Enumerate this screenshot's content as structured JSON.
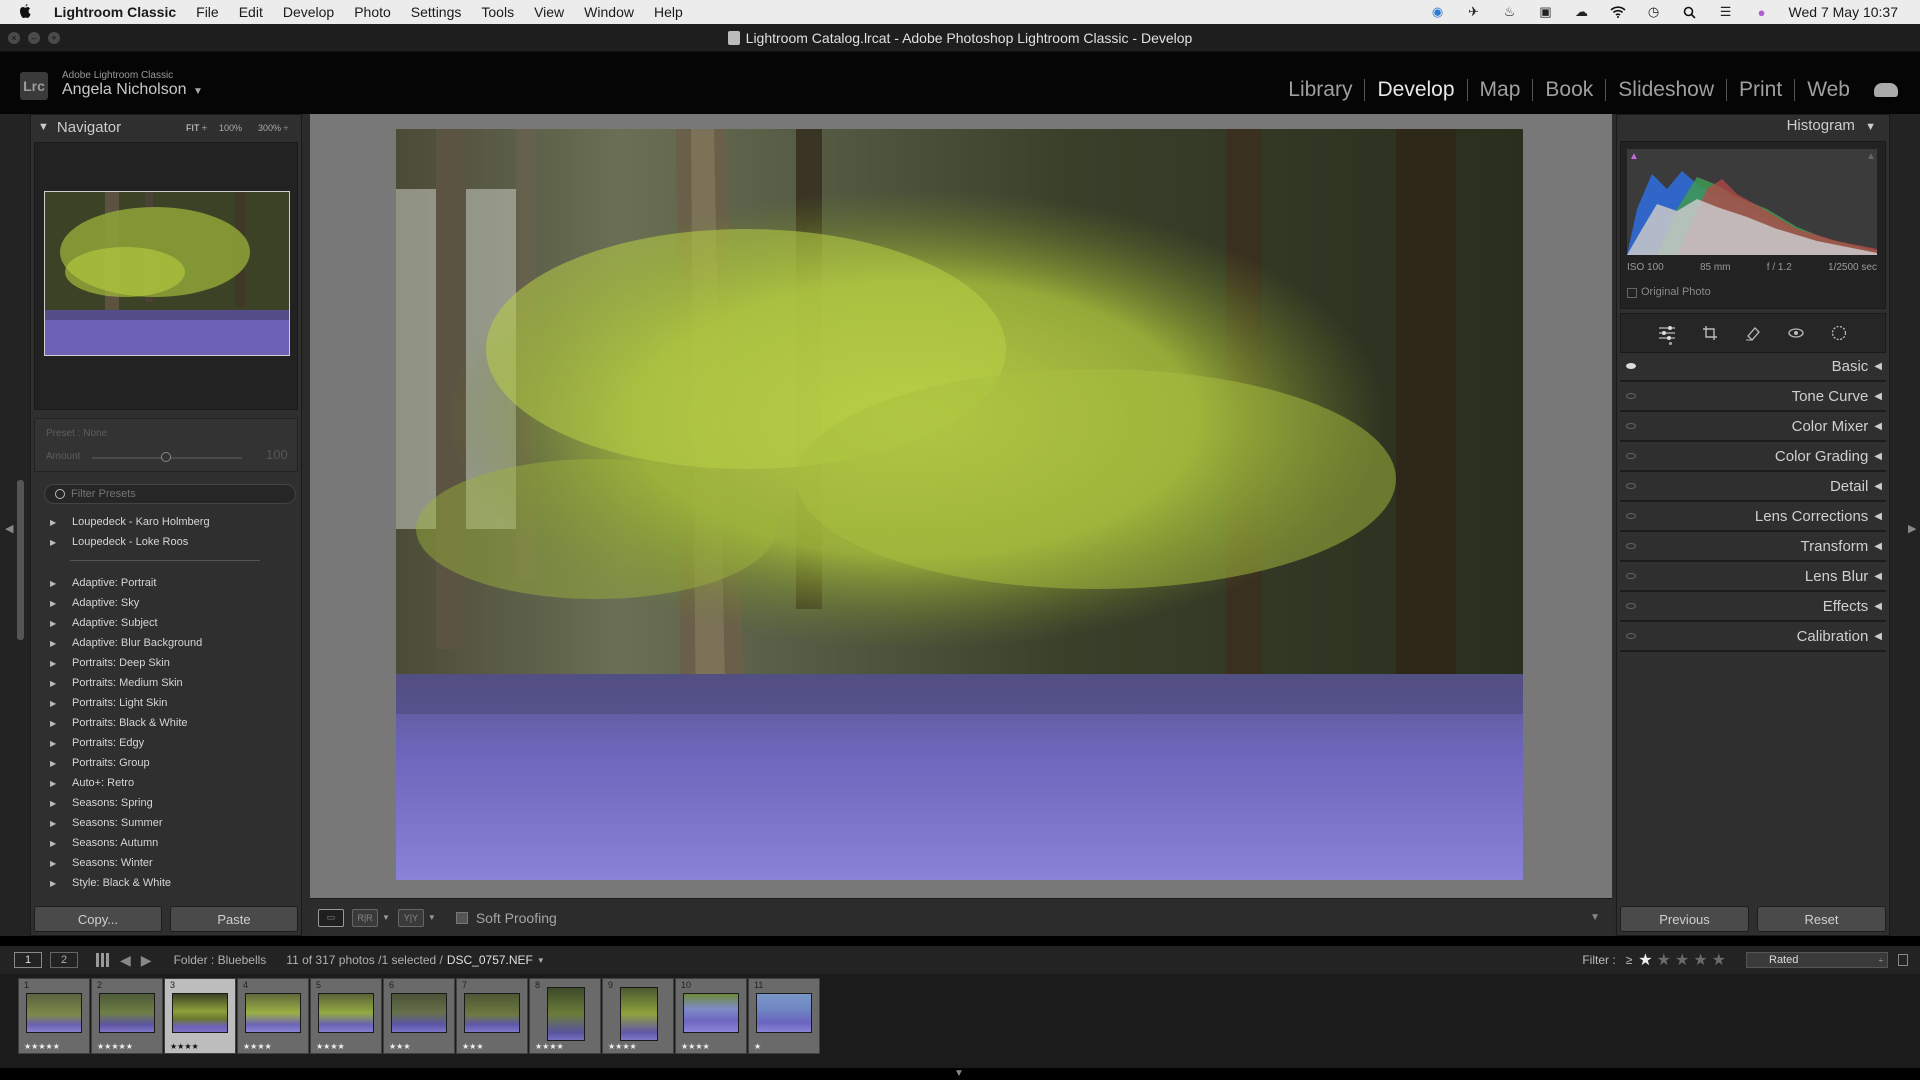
{
  "menubar": {
    "app_name": "Lightroom Classic",
    "items": [
      "File",
      "Edit",
      "Develop",
      "Photo",
      "Settings",
      "Tools",
      "View",
      "Window",
      "Help"
    ],
    "clock": "Wed 7 May  10:37"
  },
  "window": {
    "title": "Lightroom Catalog.lrcat - Adobe Photoshop Lightroom Classic - Develop"
  },
  "identity": {
    "logo": "Lrc",
    "product": "Adobe Lightroom Classic",
    "user": "Angela Nicholson"
  },
  "modules": [
    "Library",
    "Develop",
    "Map",
    "Book",
    "Slideshow",
    "Print",
    "Web"
  ],
  "active_module": "Develop",
  "navigator": {
    "title": "Navigator",
    "zoom_options": [
      "FIT ÷",
      "100%",
      "300% ÷"
    ]
  },
  "presets": {
    "preset_label": "Preset : None",
    "amount_label": "Amount",
    "amount_value": "100",
    "amount_fraction": 0.55,
    "filter_placeholder": "Filter Presets",
    "group1": [
      "Loupedeck - Karo Holmberg",
      "Loupedeck - Loke Roos"
    ],
    "group2": [
      "Adaptive: Portrait",
      "Adaptive: Sky",
      "Adaptive: Subject",
      "Adaptive: Blur Background",
      "Portraits: Deep Skin",
      "Portraits: Medium Skin",
      "Portraits: Light Skin",
      "Portraits: Black & White",
      "Portraits: Edgy",
      "Portraits: Group",
      "Auto+: Retro",
      "Seasons: Spring",
      "Seasons: Summer",
      "Seasons: Autumn",
      "Seasons: Winter",
      "Style: Black & White"
    ]
  },
  "left_buttons": {
    "copy": "Copy...",
    "paste": "Paste"
  },
  "toolbar": {
    "soft_proofing": "Soft Proofing",
    "rr": "R|R",
    "yy": "Y|Y"
  },
  "histogram": {
    "title": "Histogram",
    "iso": "ISO 100",
    "focal": "85 mm",
    "aperture": "f / 1.2",
    "shutter": "1/2500 sec",
    "original_photo": "Original Photo"
  },
  "tools": [
    "edit-sliders-icon",
    "crop-icon",
    "healing-icon",
    "redeye-icon",
    "masking-icon"
  ],
  "panels": [
    "Basic",
    "Tone Curve",
    "Color Mixer",
    "Color Grading",
    "Detail",
    "Lens Corrections",
    "Transform",
    "Lens Blur",
    "Effects",
    "Calibration"
  ],
  "right_buttons": {
    "previous": "Previous",
    "reset": "Reset"
  },
  "filmstrip_header": {
    "screen1": "1",
    "screen2": "2",
    "source": "Folder : Bluebells",
    "count": "11 of 317 photos /1 selected /",
    "filename": "DSC_0757.NEF",
    "filter_label": "Filter :",
    "filter_op": "≥",
    "filter_stars": 1,
    "rated": "Rated"
  },
  "filmstrip": [
    {
      "num": "1",
      "stars": "★★★★★",
      "selected": false
    },
    {
      "num": "2",
      "stars": "★★★★★",
      "selected": false
    },
    {
      "num": "3",
      "stars": "★★★★",
      "selected": true
    },
    {
      "num": "4",
      "stars": "★★★★",
      "selected": false
    },
    {
      "num": "5",
      "stars": "★★★★",
      "selected": false
    },
    {
      "num": "6",
      "stars": "★★★",
      "selected": false
    },
    {
      "num": "7",
      "stars": "★★★",
      "selected": false
    },
    {
      "num": "8",
      "stars": "★★★★",
      "selected": false
    },
    {
      "num": "9",
      "stars": "★★★★",
      "selected": false
    },
    {
      "num": "10",
      "stars": "★★★★",
      "selected": false
    },
    {
      "num": "11",
      "stars": "★",
      "selected": false
    }
  ],
  "colors": {
    "accent": "#e8e8e8",
    "panel": "#2f2f2f",
    "bluebell": "#7a6ec6",
    "leaf": "#b9cf3f"
  }
}
